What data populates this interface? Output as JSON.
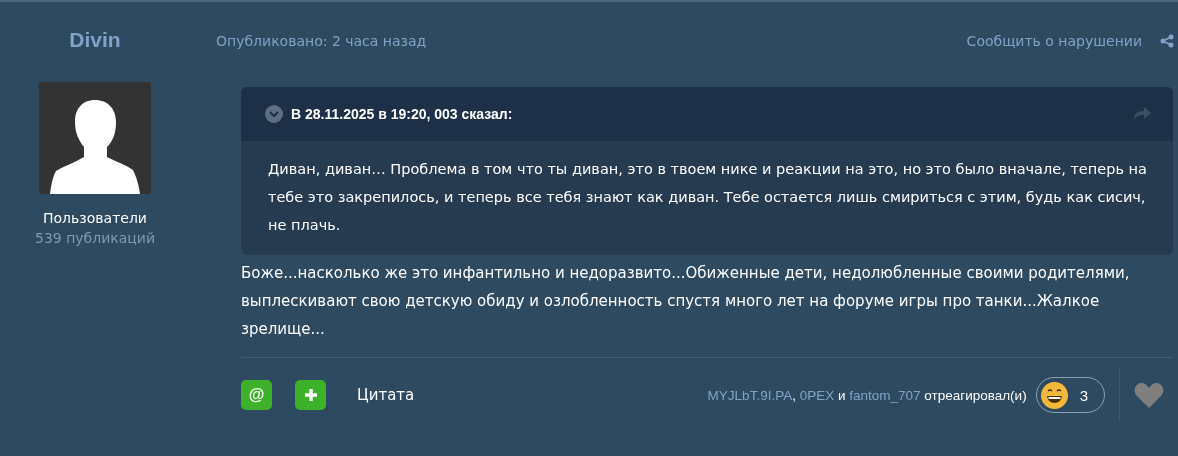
{
  "author": {
    "name": "Divin",
    "group": "Пользователи",
    "posts": "539 публикаций"
  },
  "post": {
    "published": "Опубликовано: 2 часа назад",
    "report": "Сообщить о нарушении"
  },
  "quote": {
    "header": "В 28.11.2025 в 19:20, 003 сказал:",
    "text": "Диван, диван… Проблема в том что ты диван, это в твоем нике и реакции на это, но это было вначале, теперь на тебе это закрепилось, и теперь все тебя знают как диван. Тебе остается лишь смириться с этим, будь как сисич, не плачь."
  },
  "body": "Боже...насколько же это инфантильно и недоразвито...Обиженные дети, недолюбленные своими родителями, выплескивают свою детскую обиду и озлобленность спустя много лет на форуме игры про танки...Жалкое зрелище...",
  "actions": {
    "mention": "@",
    "quote": "Цитата"
  },
  "reactions": {
    "users": [
      "MYJLbT.9I.PA",
      "0PEX",
      "fantom_707"
    ],
    "comma": ",",
    "joiner": "и",
    "suffix": "отреагировал(и)",
    "count": "3"
  }
}
